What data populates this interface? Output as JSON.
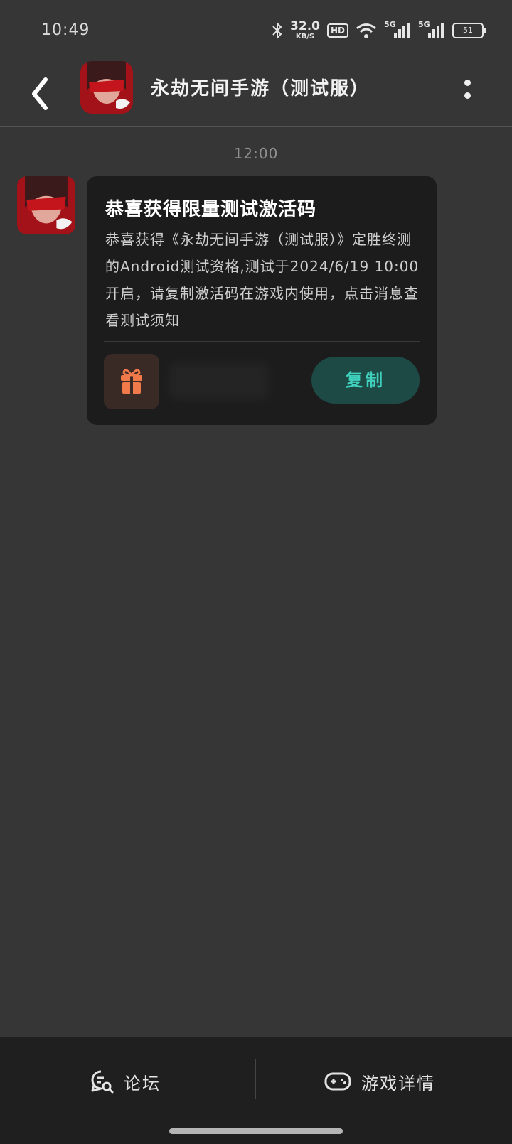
{
  "status_bar": {
    "time": "10:49",
    "net_speed_value": "32.0",
    "net_speed_unit": "KB/S",
    "hd_badge": "HD",
    "sim1": "5G",
    "sim2": "5G",
    "battery": "51"
  },
  "header": {
    "title": "永劫无间手游（测试服）",
    "back_icon": "chevron-left-icon",
    "more_icon": "vertical-dots-icon"
  },
  "chat": {
    "timestamp": "12:00",
    "message": {
      "title": "恭喜获得限量测试激活码",
      "body": "恭喜获得《永劫无间手游（测试服）》定胜终测的Android测试资格,测试于2024/6/19 10:00 开启，请复制激活码在游戏内使用，点击消息查看测试须知",
      "gift_icon": "gift-icon",
      "copy_label": "复制"
    }
  },
  "bottom_nav": {
    "forum_label": "论坛",
    "forum_icon": "forum-search-icon",
    "details_label": "游戏详情",
    "details_icon": "gamepad-icon"
  },
  "colors": {
    "background": "#363636",
    "card": "#1c1c1c",
    "accent": "#3fd1bd",
    "gift": "#f07a4a"
  }
}
